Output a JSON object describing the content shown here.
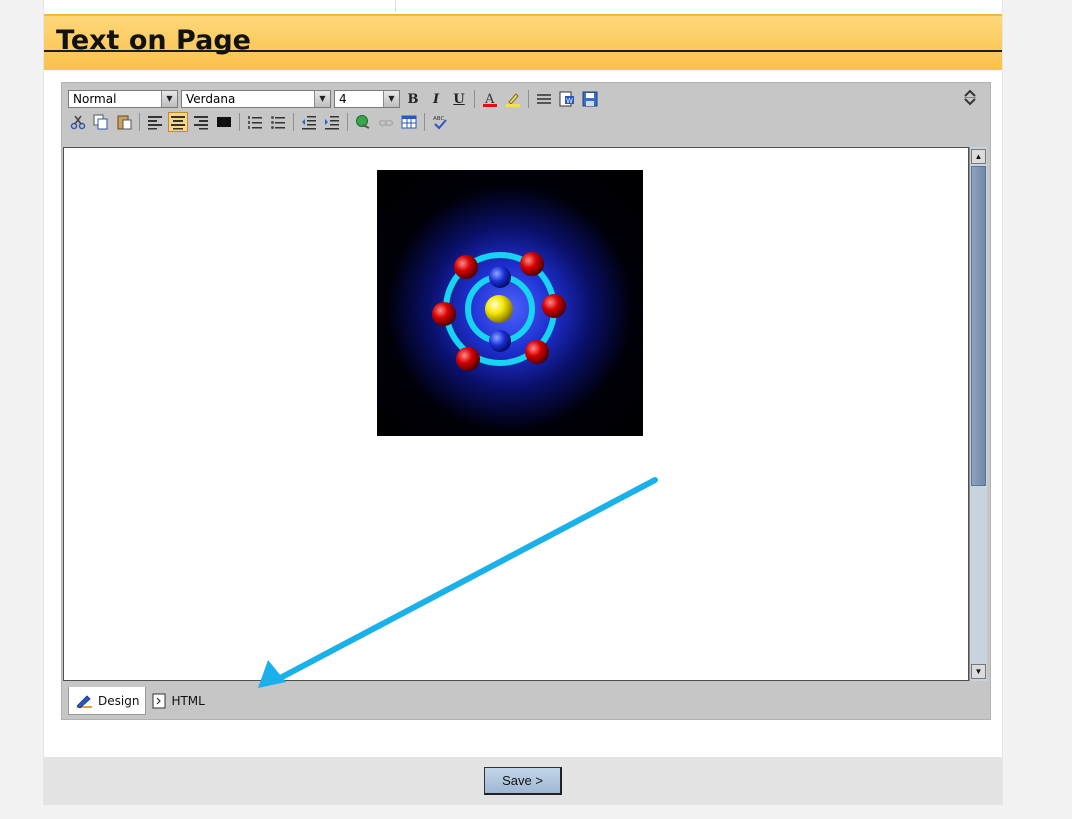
{
  "header": {
    "title": "Text on Page"
  },
  "toolbar": {
    "style_select": "Normal",
    "font_select": "Verdana",
    "size_select": "4",
    "bold_label": "B",
    "italic_label": "I",
    "underline_label": "U"
  },
  "editor": {
    "tabs": [
      {
        "label": "Design",
        "active": true
      },
      {
        "label": "HTML",
        "active": false
      }
    ]
  },
  "footer": {
    "save_label": "Save >"
  },
  "colors": {
    "header_bg": "#fbc14a",
    "annotation_arrow": "#1ab0ea",
    "active_tool": "#fbd589",
    "save_button": "#b3c9e0"
  }
}
